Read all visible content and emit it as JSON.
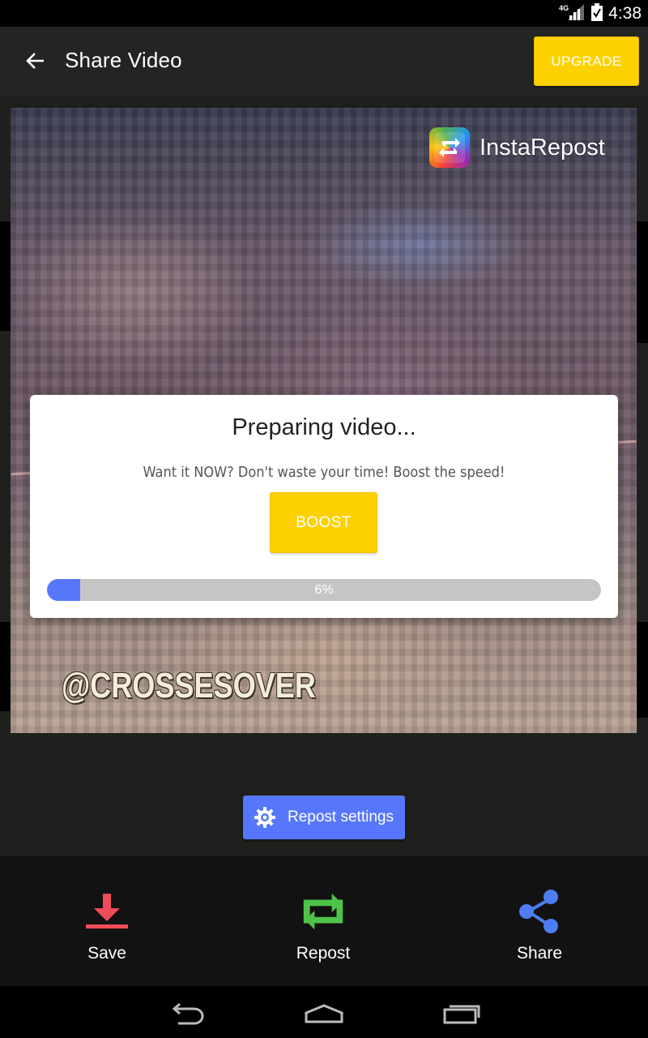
{
  "status_bar": {
    "network": "4G",
    "time": "4:38",
    "icons": [
      "signal-icon",
      "battery-icon"
    ]
  },
  "app_bar": {
    "title": "Share Video",
    "upgrade_label": "UPGRADE",
    "back_icon": "arrow-back-icon"
  },
  "video": {
    "watermark_text": "InstaRepost",
    "handle_text": "@CROSSESOVER"
  },
  "dialog": {
    "title": "Preparing video...",
    "message": "Want it NOW? Don't waste your time! Boost the speed!",
    "boost_label": "BOOST",
    "progress_percent": 6,
    "progress_label": "6%"
  },
  "repost_settings": {
    "label": "Repost settings",
    "icon": "gear-icon"
  },
  "actions": [
    {
      "label": "Save",
      "icon": "download-icon",
      "color": "#f04b58"
    },
    {
      "label": "Repost",
      "icon": "repost-icon",
      "color": "#4fc24a"
    },
    {
      "label": "Share",
      "icon": "share-icon",
      "color": "#4d7df0"
    }
  ],
  "nav": [
    "back-nav-icon",
    "home-nav-icon",
    "recents-nav-icon"
  ],
  "colors": {
    "accent_yellow": "#fdd100",
    "accent_blue": "#5677fc",
    "app_bar_bg": "#242522",
    "background": "#1f201d"
  }
}
